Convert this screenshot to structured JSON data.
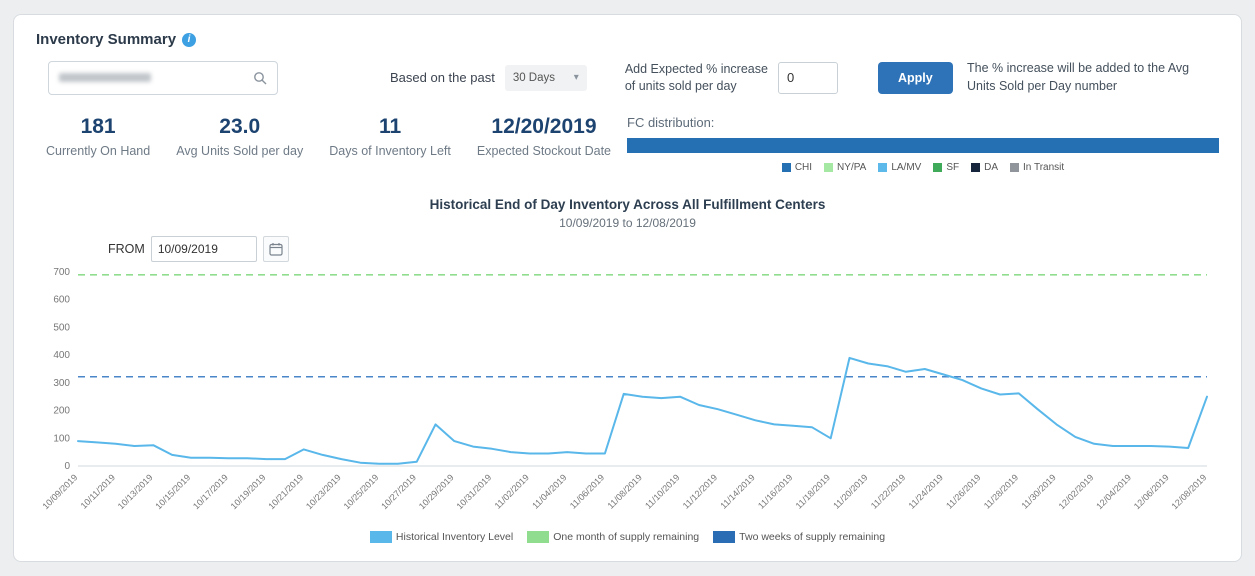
{
  "header": {
    "title": "Inventory Summary"
  },
  "controls": {
    "based_on_label": "Based on the past",
    "period_select": "30 Days",
    "increase_label_line1": "Add Expected % increase",
    "increase_label_line2": "of units sold per day",
    "increase_value": "0",
    "apply_label": "Apply",
    "helper_text": "The % increase will be added to the Avg Units Sold per Day number"
  },
  "stats": [
    {
      "value": "181",
      "label": "Currently On Hand"
    },
    {
      "value": "23.0",
      "label": "Avg Units Sold per day"
    },
    {
      "value": "11",
      "label": "Days of Inventory Left"
    },
    {
      "value": "12/20/2019",
      "label": "Expected Stockout Date"
    }
  ],
  "fc_distribution": {
    "label": "FC distribution:",
    "segments": [
      {
        "name": "CHI",
        "color": "#2470b3",
        "pct": 100
      }
    ],
    "legend": [
      {
        "name": "CHI",
        "color": "#2470b3"
      },
      {
        "name": "NY/PA",
        "color": "#a4e8a4"
      },
      {
        "name": "LA/MV",
        "color": "#5cb9ea"
      },
      {
        "name": "SF",
        "color": "#3faa5a"
      },
      {
        "name": "DA",
        "color": "#16253c"
      },
      {
        "name": "In Transit",
        "color": "#8f959b"
      }
    ]
  },
  "chart_controls": {
    "from_label": "FROM",
    "from_value": "10/09/2019"
  },
  "chart_data": {
    "type": "line",
    "title": "Historical End of Day Inventory Across All Fulfillment Centers",
    "subtitle": "10/09/2019 to 12/08/2019",
    "ylim": [
      0,
      700
    ],
    "yticks": [
      0,
      100,
      200,
      300,
      400,
      500,
      600,
      700
    ],
    "x_labels": [
      "10/09/2019",
      "10/11/2019",
      "10/13/2019",
      "10/15/2019",
      "10/17/2019",
      "10/19/2019",
      "10/21/2019",
      "10/23/2019",
      "10/25/2019",
      "10/27/2019",
      "10/29/2019",
      "10/31/2019",
      "11/02/2019",
      "11/04/2019",
      "11/06/2019",
      "11/08/2019",
      "11/10/2019",
      "11/12/2019",
      "11/14/2019",
      "11/16/2019",
      "11/18/2019",
      "11/20/2019",
      "11/22/2019",
      "11/24/2019",
      "11/26/2019",
      "11/28/2019",
      "11/30/2019",
      "12/02/2019",
      "12/04/2019",
      "12/06/2019",
      "12/08/2019"
    ],
    "series": [
      {
        "name": "Historical Inventory Level",
        "color": "#59b7ea",
        "values": [
          90,
          85,
          80,
          72,
          75,
          40,
          30,
          30,
          28,
          28,
          25,
          25,
          60,
          40,
          25,
          12,
          8,
          8,
          15,
          150,
          90,
          70,
          62,
          50,
          45,
          45,
          50,
          45,
          45,
          260,
          250,
          245,
          250,
          220,
          205,
          185,
          165,
          150,
          145,
          140,
          100,
          390,
          370,
          360,
          340,
          350,
          330,
          310,
          280,
          258,
          262,
          205,
          150,
          105,
          80,
          72,
          72,
          72,
          70,
          65,
          250
        ]
      }
    ],
    "reference_lines": [
      {
        "name": "One month of supply remaining",
        "value": 690,
        "color": "#90dd90",
        "style": "dashed"
      },
      {
        "name": "Two weeks of supply remaining",
        "value": 322,
        "color": "#4a86c8",
        "style": "dashed"
      }
    ],
    "legend_items": [
      {
        "label": "Historical Inventory Level",
        "color": "#59b7ea"
      },
      {
        "label": "One month of supply remaining",
        "color": "#90dd90"
      },
      {
        "label": "Two weeks of supply remaining",
        "color": "#2a6db5"
      }
    ]
  }
}
